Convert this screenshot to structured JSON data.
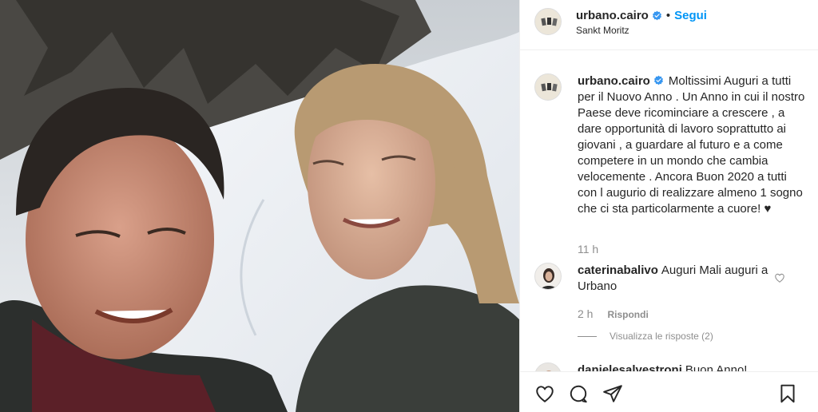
{
  "post": {
    "username": "urbano.cairo",
    "separator": "•",
    "follow_label": "Segui",
    "location": "Sankt Moritz"
  },
  "caption": {
    "username": "urbano.cairo",
    "text": "Moltissimi Auguri a tutti per il Nuovo Anno . Un Anno in cui il nostro Paese deve ricominciare a crescere , a dare opportunità di lavoro soprattutto ai giovani , a guardare al futuro e a come competere in un mondo che cambia velocemente . Ancora Buon 2020 a tutti con l augurio di realizzare almeno 1 sogno che ci sta particolarmente a cuore! ♥",
    "time": "11 h"
  },
  "comments": [
    {
      "username": "caterinabalivo",
      "text": "Auguri Mali auguri a Urbano",
      "time": "2 h",
      "reply_label": "Rispondi",
      "view_replies_label": "Visualizza le risposte (2)"
    },
    {
      "username": "danielesalvestroni",
      "text": "Buon Anno!"
    }
  ],
  "icons": {
    "verified": "verified-badge-icon",
    "like": "heart-icon",
    "comment": "comment-bubble-icon",
    "share": "paper-plane-icon",
    "save": "bookmark-icon"
  },
  "colors": {
    "link_blue": "#0095f6",
    "verified_blue": "#3897f0",
    "muted": "#8e8e8e",
    "divider": "#efefef"
  }
}
